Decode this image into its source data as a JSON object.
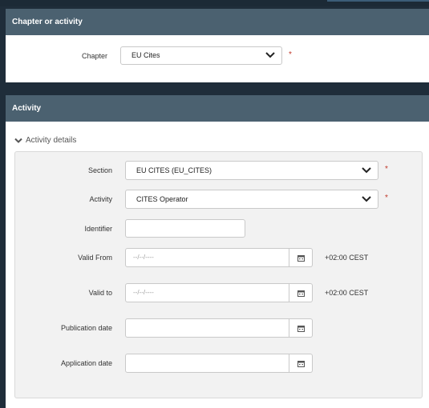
{
  "chapter_panel": {
    "title": "Chapter or activity",
    "chapter_label": "Chapter",
    "chapter_value": "EU Cites",
    "required_mark": "*"
  },
  "activity_panel": {
    "title": "Activity",
    "details_toggle": "Activity details",
    "section": {
      "label": "Section",
      "value": "EU CITES (EU_CITES)",
      "required_mark": "*"
    },
    "activity": {
      "label": "Activity",
      "value": "CITES Operator",
      "required_mark": "*"
    },
    "identifier": {
      "label": "Identifier",
      "value": ""
    },
    "valid_from": {
      "label": "Valid From",
      "placeholder": "--/--/----",
      "timezone": "+02:00 CEST"
    },
    "valid_to": {
      "label": "Valid to",
      "placeholder": "--/--/----",
      "timezone": "+02:00 CEST"
    },
    "publication_date": {
      "label": "Publication date",
      "value": ""
    },
    "application_date": {
      "label": "Application date",
      "value": ""
    }
  },
  "icons": {
    "dropdown": "chevron-down-icon",
    "calendar": "calendar-icon",
    "toggle": "chevron-down-icon"
  },
  "colors": {
    "panel_header": "#4b6170",
    "background": "#1f2d3a",
    "required": "#c0392b"
  }
}
